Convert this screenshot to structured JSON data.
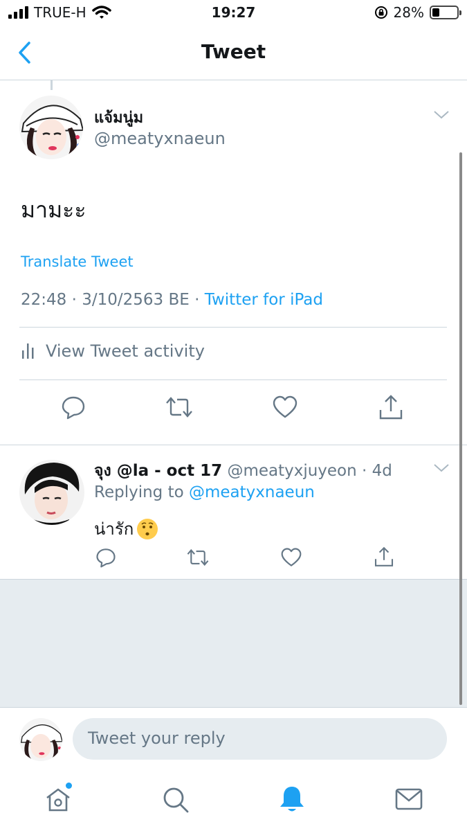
{
  "status_bar": {
    "carrier": "TRUE-H",
    "time": "19:27",
    "battery": "28%",
    "battery_level": 0.28
  },
  "nav": {
    "title": "Tweet",
    "back_icon": "chevron-left-icon"
  },
  "main_tweet": {
    "display_name": "แจ้มนู่ม",
    "handle": "@meatyxnaeun",
    "text": "มามะะ",
    "translate": "Translate Tweet",
    "time": "22:48",
    "date": "3/10/2563 BE",
    "separator": "·",
    "source": "Twitter for iPad",
    "activity": "View Tweet activity"
  },
  "reply": {
    "display_name": "จุง @la - oct 17",
    "handle": "@meatyxjuyeon",
    "age": "· 4d",
    "replying_prefix": "Replying to",
    "replying_to": "@meatyxnaeun",
    "text": "น่ารัก",
    "emoji": "kissing-face-emoji"
  },
  "composer": {
    "placeholder": "Tweet your reply"
  },
  "tabs": [
    "home-icon",
    "search-icon",
    "notifications-icon",
    "messages-icon"
  ],
  "colors": {
    "accent": "#1da1f2",
    "secondary_text": "#657786",
    "divider": "#ccd6dd",
    "background_gray": "#e6ecf0"
  }
}
